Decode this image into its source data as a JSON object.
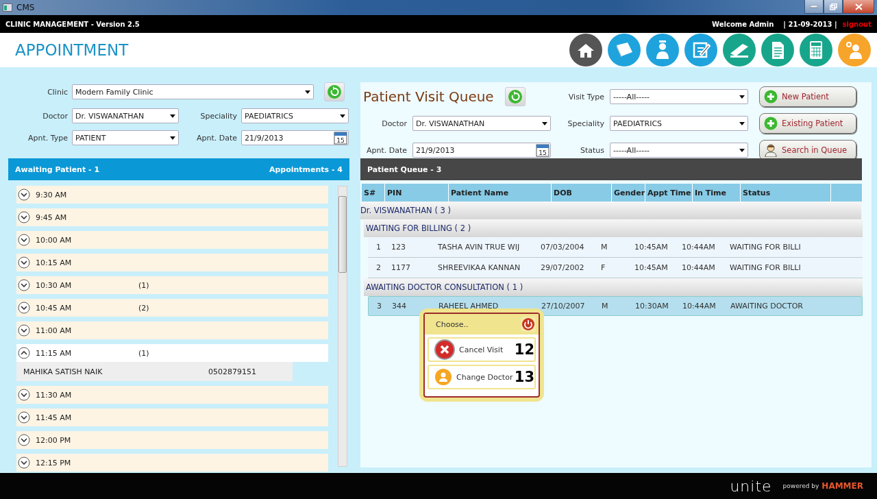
{
  "window": {
    "title": "CMS"
  },
  "top_bar": {
    "title": "CLINIC MANAGEMENT - Version 2.5",
    "welcome": "Welcome Admin",
    "date": "| 21-09-2013 |",
    "signout": "signout"
  },
  "page_title": "APPOINTMENT",
  "nav_icons": [
    {
      "kind": "home"
    },
    {
      "kind": "papers"
    },
    {
      "kind": "nurse"
    },
    {
      "kind": "edit"
    },
    {
      "kind": "scanner"
    },
    {
      "kind": "document"
    },
    {
      "kind": "calculator"
    },
    {
      "kind": "admin"
    }
  ],
  "appointment_filters": {
    "clinic": {
      "label": "Clinic",
      "value": "Modern Family Clinic"
    },
    "doctor": {
      "label": "Doctor",
      "value": "Dr. VISWANATHAN"
    },
    "speciality": {
      "label": "Speciality",
      "value": "PAEDIATRICS"
    },
    "apnt_type": {
      "label": "Apnt. Type",
      "value": "PATIENT"
    },
    "apnt_date": {
      "label": "Apnt. Date",
      "value": "21/9/2013"
    },
    "calendar_day": "15"
  },
  "awaiting_header": {
    "left": "Awaiting Patient - 1",
    "right": "Appointments - 4"
  },
  "slots": [
    {
      "time": "9:30 AM",
      "expanded": false
    },
    {
      "time": "9:45 AM",
      "expanded": false
    },
    {
      "time": "10:00 AM",
      "expanded": false
    },
    {
      "time": "10:15 AM",
      "expanded": false
    },
    {
      "time": "10:30 AM",
      "count": "(1)",
      "expanded": false
    },
    {
      "time": "10:45 AM",
      "count": "(2)",
      "expanded": false
    },
    {
      "time": "11:00 AM",
      "expanded": false
    },
    {
      "time": "11:15 AM",
      "count": "(1)",
      "expanded": true,
      "children": [
        {
          "name": "MAHIKA SATISH NAIK",
          "phone": "0502879151"
        }
      ]
    },
    {
      "time": "11:30 AM",
      "expanded": false
    },
    {
      "time": "11:45 AM",
      "expanded": false
    },
    {
      "time": "12:00 PM",
      "expanded": false
    },
    {
      "time": "12:15 PM",
      "expanded": false
    }
  ],
  "queue": {
    "title": "Patient Visit Queue",
    "visit_type": {
      "label": "Visit Type",
      "value": "-----All-----"
    },
    "doctor": {
      "label": "Doctor",
      "value": "Dr. VISWANATHAN"
    },
    "speciality": {
      "label": "Speciality",
      "value": "PAEDIATRICS"
    },
    "apnt_date": {
      "label": "Apnt. Date",
      "value": "21/9/2013"
    },
    "status": {
      "label": "Status",
      "value": "-----All-----"
    },
    "calendar_day": "15",
    "buttons": [
      {
        "label": "New Patient",
        "kind": "plus"
      },
      {
        "label": "Existing Patient",
        "kind": "plus"
      },
      {
        "label": "Search in Queue",
        "kind": "person"
      }
    ],
    "header": "Patient Queue - 3"
  },
  "table": {
    "columns": [
      "S#",
      "PIN",
      "Patient Name",
      "DOB",
      "Gender",
      "Appt Time",
      "In Time",
      "Status"
    ],
    "groups": [
      {
        "label": "Dr. VISWANATHAN ( 3 )",
        "children": [
          {
            "label": "WAITING FOR BILLING ( 2 )",
            "rows": [
              {
                "selected": false,
                "cells": [
                  "1",
                  "123",
                  "TASHA AVIN TRUE WIJ",
                  "07/03/2004",
                  "M",
                  "10:45AM",
                  "10:44AM",
                  "WAITING FOR BILLI"
                ]
              },
              {
                "selected": false,
                "cells": [
                  "2",
                  "1177",
                  "SHREEVIKAA KANNAN",
                  "29/07/2002",
                  "F",
                  "10:45AM",
                  "10:44AM",
                  "WAITING FOR BILLI"
                ]
              }
            ]
          },
          {
            "label": "AWAITING DOCTOR CONSULTATION ( 1 )",
            "rows": [
              {
                "selected": true,
                "cells": [
                  "3",
                  "344",
                  "RAHEEL AHMED",
                  "27/10/2007",
                  "M",
                  "10:30AM",
                  "10:44AM",
                  "AWAITING DOCTOR"
                ]
              }
            ]
          }
        ]
      }
    ]
  },
  "popup": {
    "title": "Choose..",
    "items": [
      {
        "label": "Cancel Visit",
        "kind": "cancel",
        "number": "12"
      },
      {
        "label": "Change Doctor",
        "kind": "doctor",
        "number": "13"
      }
    ]
  },
  "footer": {
    "logo": "unite",
    "powered": "powered by",
    "brand": "HAMMER"
  }
}
